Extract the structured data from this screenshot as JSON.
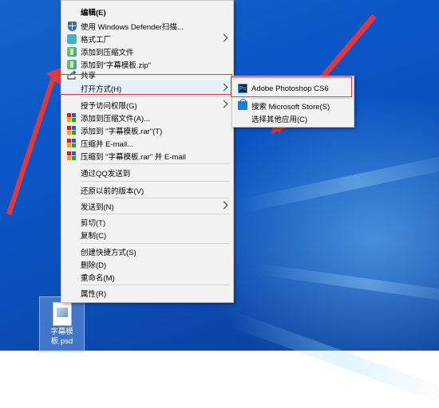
{
  "context_menu": {
    "items": [
      {
        "label": "编辑(E)",
        "bold": true
      },
      {
        "label": "使用 Windows Defender扫描...",
        "icon": "shield-icon"
      },
      {
        "label": "格式工厂",
        "icon": "format-factory-icon",
        "submenu": true
      },
      {
        "label": "添加到压缩文件",
        "icon": "zip-icon"
      },
      {
        "label": "添加到\"字幕模板.zip\"",
        "icon": "zip-icon"
      },
      {
        "label": "共享",
        "icon": "share-icon"
      },
      {
        "label": "打开方式(H)",
        "submenu": true,
        "highlighted": true
      },
      {
        "label": "授予访问权限(G)",
        "submenu": true
      },
      {
        "label": "添加到压缩文件(A)...",
        "icon": "winrar-icon"
      },
      {
        "label": "添加到 \"字幕模板.rar\"(T)",
        "icon": "winrar-icon"
      },
      {
        "label": "压缩并 E-mail...",
        "icon": "winrar-icon"
      },
      {
        "label": "压缩到 \"字幕模板.rar\" 并 E-mail",
        "icon": "winrar-icon"
      },
      {
        "label": "通过QQ发送到"
      },
      {
        "label": "还原以前的版本(V)"
      },
      {
        "label": "发送到(N)",
        "submenu": true
      },
      {
        "label": "剪切(T)"
      },
      {
        "label": "复制(C)"
      },
      {
        "label": "创建快捷方式(S)"
      },
      {
        "label": "删除(D)"
      },
      {
        "label": "重命名(M)"
      },
      {
        "label": "属性(R)"
      }
    ]
  },
  "submenu": {
    "items": [
      {
        "label": "Adobe Photoshop CS6",
        "icon": "photoshop-icon",
        "icon_text": "Ps"
      },
      {
        "label": "搜索 Microsoft Store(S)",
        "icon": "microsoft-store-icon"
      },
      {
        "label": "选择其他应用(C)"
      }
    ]
  },
  "desktop_file": {
    "name": "字幕模板.psd"
  },
  "colors": {
    "annotation": "#e3383a",
    "highlight": "#e5f0fb",
    "desktop": "#0a55c8"
  }
}
